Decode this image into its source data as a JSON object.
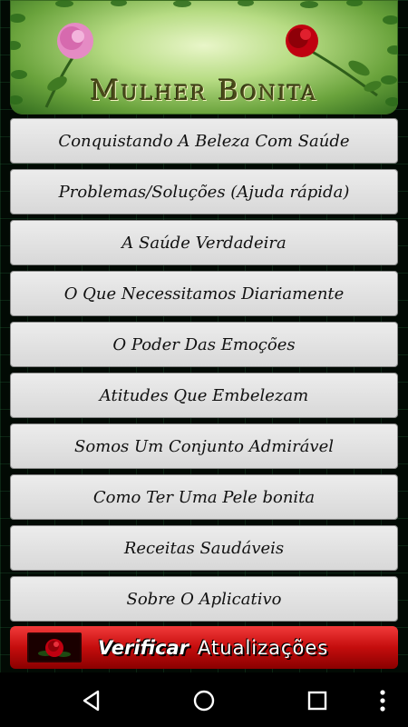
{
  "header": {
    "title": "Mulher Bonita"
  },
  "menu": {
    "items": [
      {
        "label": "Conquistando A Beleza Com Saúde"
      },
      {
        "label": "Problemas/Soluções (Ajuda rápida)"
      },
      {
        "label": "A Saúde Verdadeira"
      },
      {
        "label": "O Que Necessitamos Diariamente"
      },
      {
        "label": "O Poder Das Emoções"
      },
      {
        "label": "Atitudes Que Embelezam"
      },
      {
        "label": "Somos Um Conjunto Admirável"
      },
      {
        "label": "Como Ter Uma Pele bonita"
      },
      {
        "label": "Receitas Saudáveis"
      },
      {
        "label": "Sobre O Aplicativo"
      }
    ]
  },
  "update": {
    "label_bold": "Verificar",
    "label_rest": "Atualizações",
    "icon": "rose-icon"
  },
  "navbar": {
    "back_icon": "back-triangle-icon",
    "home_icon": "home-circle-icon",
    "recents_icon": "recents-square-icon",
    "menu_icon": "overflow-dots-icon"
  },
  "colors": {
    "accent_red": "#c40d0d",
    "banner_green": "#6aa33c",
    "button_grey": "#e0e0e0"
  }
}
